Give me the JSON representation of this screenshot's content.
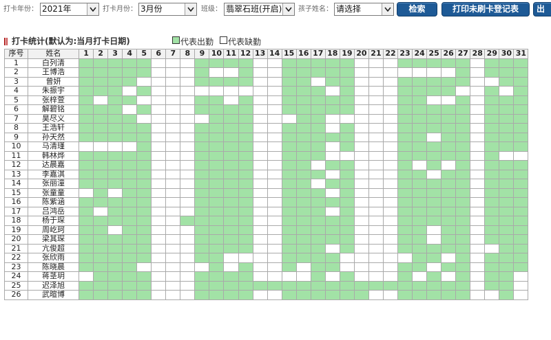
{
  "filters": {
    "year_label": "打卡年份：",
    "year_value": "2021年",
    "month_label": "打卡月份：",
    "month_value": "3月份",
    "class_label": "班级：",
    "class_value": "翡翠石班(开启)",
    "child_label": "孩子姓名：",
    "child_value": "请选择",
    "search_button": "检索",
    "print_button": "打印未刷卡登记表",
    "export_button": "出"
  },
  "section": {
    "title": "打卡统计(默认为:当月打卡日期)",
    "legend_present": "代表出勤",
    "legend_absent": "代表缺勤"
  },
  "colors": {
    "present": "#a2e2a6",
    "absent": "#ffffff",
    "button_bg": "#1e5a96",
    "title_mark": "#b22222"
  },
  "table": {
    "col_seq": "序号",
    "col_name": "姓名",
    "days": [
      "1",
      "2",
      "3",
      "4",
      "5",
      "6",
      "7",
      "8",
      "9",
      "10",
      "11",
      "12",
      "13",
      "14",
      "15",
      "16",
      "17",
      "18",
      "19",
      "20",
      "21",
      "22",
      "23",
      "24",
      "25",
      "26",
      "27",
      "28",
      "29",
      "30",
      "31"
    ],
    "rows": [
      {
        "seq": "1",
        "name": "白列清",
        "att": "1111100011110011111000111110111"
      },
      {
        "seq": "2",
        "name": "王博浩",
        "att": "1111100010010011111000000010111"
      },
      {
        "seq": "3",
        "name": "曾妍",
        "att": "1111000011110011011000111110011"
      },
      {
        "seq": "4",
        "name": "朱振宇",
        "att": "1110100000000011101000111100101"
      },
      {
        "seq": "5",
        "name": "张梓萱",
        "att": "1011000011010011111000110010111"
      },
      {
        "seq": "6",
        "name": "解碧铭",
        "att": "1110100011110011111000111110111"
      },
      {
        "seq": "7",
        "name": "昊尽义",
        "att": "1111000001110001100000111110111"
      },
      {
        "seq": "8",
        "name": "王浩轩",
        "att": "1111100011110011101000111110111"
      },
      {
        "seq": "9",
        "name": "孙天然",
        "att": "1111100011110011111000110110111"
      },
      {
        "seq": "10",
        "name": "马清瑾",
        "att": "0000100011110011101000111110111"
      },
      {
        "seq": "11",
        "name": "韩林烨",
        "att": "1111100011110011100000111110100"
      },
      {
        "seq": "12",
        "name": "达晨嘉",
        "att": "1111100011110011011000101010111"
      },
      {
        "seq": "13",
        "name": "李嘉淇",
        "att": "1111100011110011101000110110111"
      },
      {
        "seq": "14",
        "name": "张丽潼",
        "att": "1111100011110011011000111110111"
      },
      {
        "seq": "15",
        "name": "张童童",
        "att": "0101100011110011101000111110111"
      },
      {
        "seq": "16",
        "name": "陈紫涵",
        "att": "1111100011110011111000111110111"
      },
      {
        "seq": "17",
        "name": "吕鸿岳",
        "att": "1011100011110011101000111110111"
      },
      {
        "seq": "18",
        "name": "杨于琛",
        "att": "1111100111110011111000111110111"
      },
      {
        "seq": "19",
        "name": "周屹珂",
        "att": "1101100011110011111000110110111"
      },
      {
        "seq": "20",
        "name": "梁其琛",
        "att": "1111100011110011111000110110111"
      },
      {
        "seq": "21",
        "name": "亢俊超",
        "att": "1111100011110011101000111110011"
      },
      {
        "seq": "22",
        "name": "张欣雨",
        "att": "1111100011000011110000011010111"
      },
      {
        "seq": "23",
        "name": "陈晓晨",
        "att": "1111000001010010110000110110111"
      },
      {
        "seq": "24",
        "name": "蒋茎玥",
        "att": "0111100011110000101000101010110"
      },
      {
        "seq": "25",
        "name": "迟泽旭",
        "att": "1111100011111111111111111110110"
      },
      {
        "seq": "26",
        "name": "武暄博",
        "att": "1111100011110011111100111110010"
      }
    ]
  }
}
